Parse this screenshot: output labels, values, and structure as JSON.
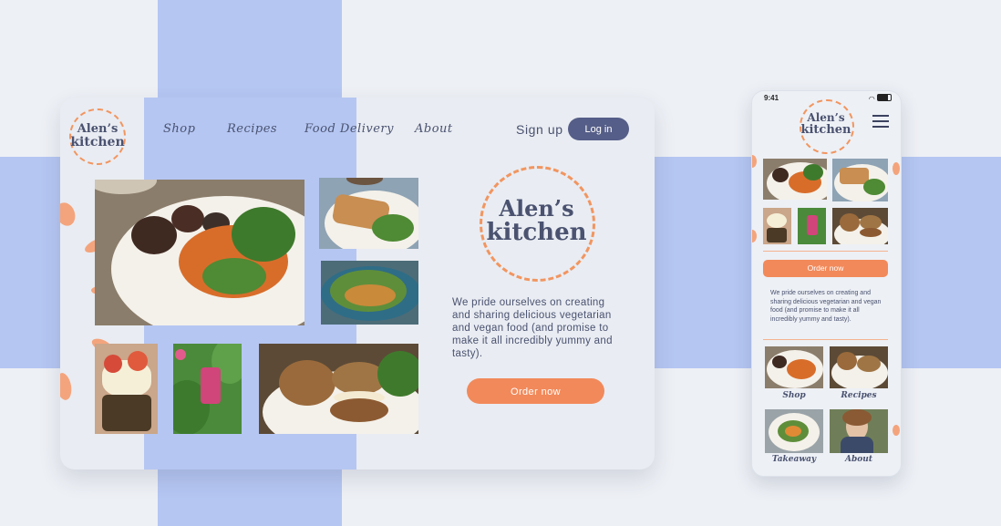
{
  "brand": {
    "line1": "Alen’s",
    "line2": "kitchen"
  },
  "nav": {
    "items": [
      {
        "label": "Shop"
      },
      {
        "label": "Recipes"
      },
      {
        "label": "Food Delivery"
      },
      {
        "label": "About"
      }
    ],
    "signup_label": "Sign up",
    "login_label": "Log in"
  },
  "hero": {
    "tagline": "We pride ourselves on creating and sharing delicious vegetarian and vegan food (and promise to make it all incredibly yummy and tasty).",
    "order_label": "Order now"
  },
  "mobile": {
    "status_time": "9:41",
    "order_label": "Order now",
    "tagline": "We pride ourselves on creating and sharing delicious vegetarian and vegan food (and promise to make it all incredibly yummy and tasty).",
    "tiles": [
      {
        "label": "Shop"
      },
      {
        "label": "Recipes"
      },
      {
        "label": "Takeaway"
      },
      {
        "label": "About"
      }
    ]
  },
  "colors": {
    "accent": "#f2895a",
    "navy": "#4a5270",
    "login": "#555e88",
    "band": "#b5c6f2",
    "background": "#edf0f5"
  }
}
